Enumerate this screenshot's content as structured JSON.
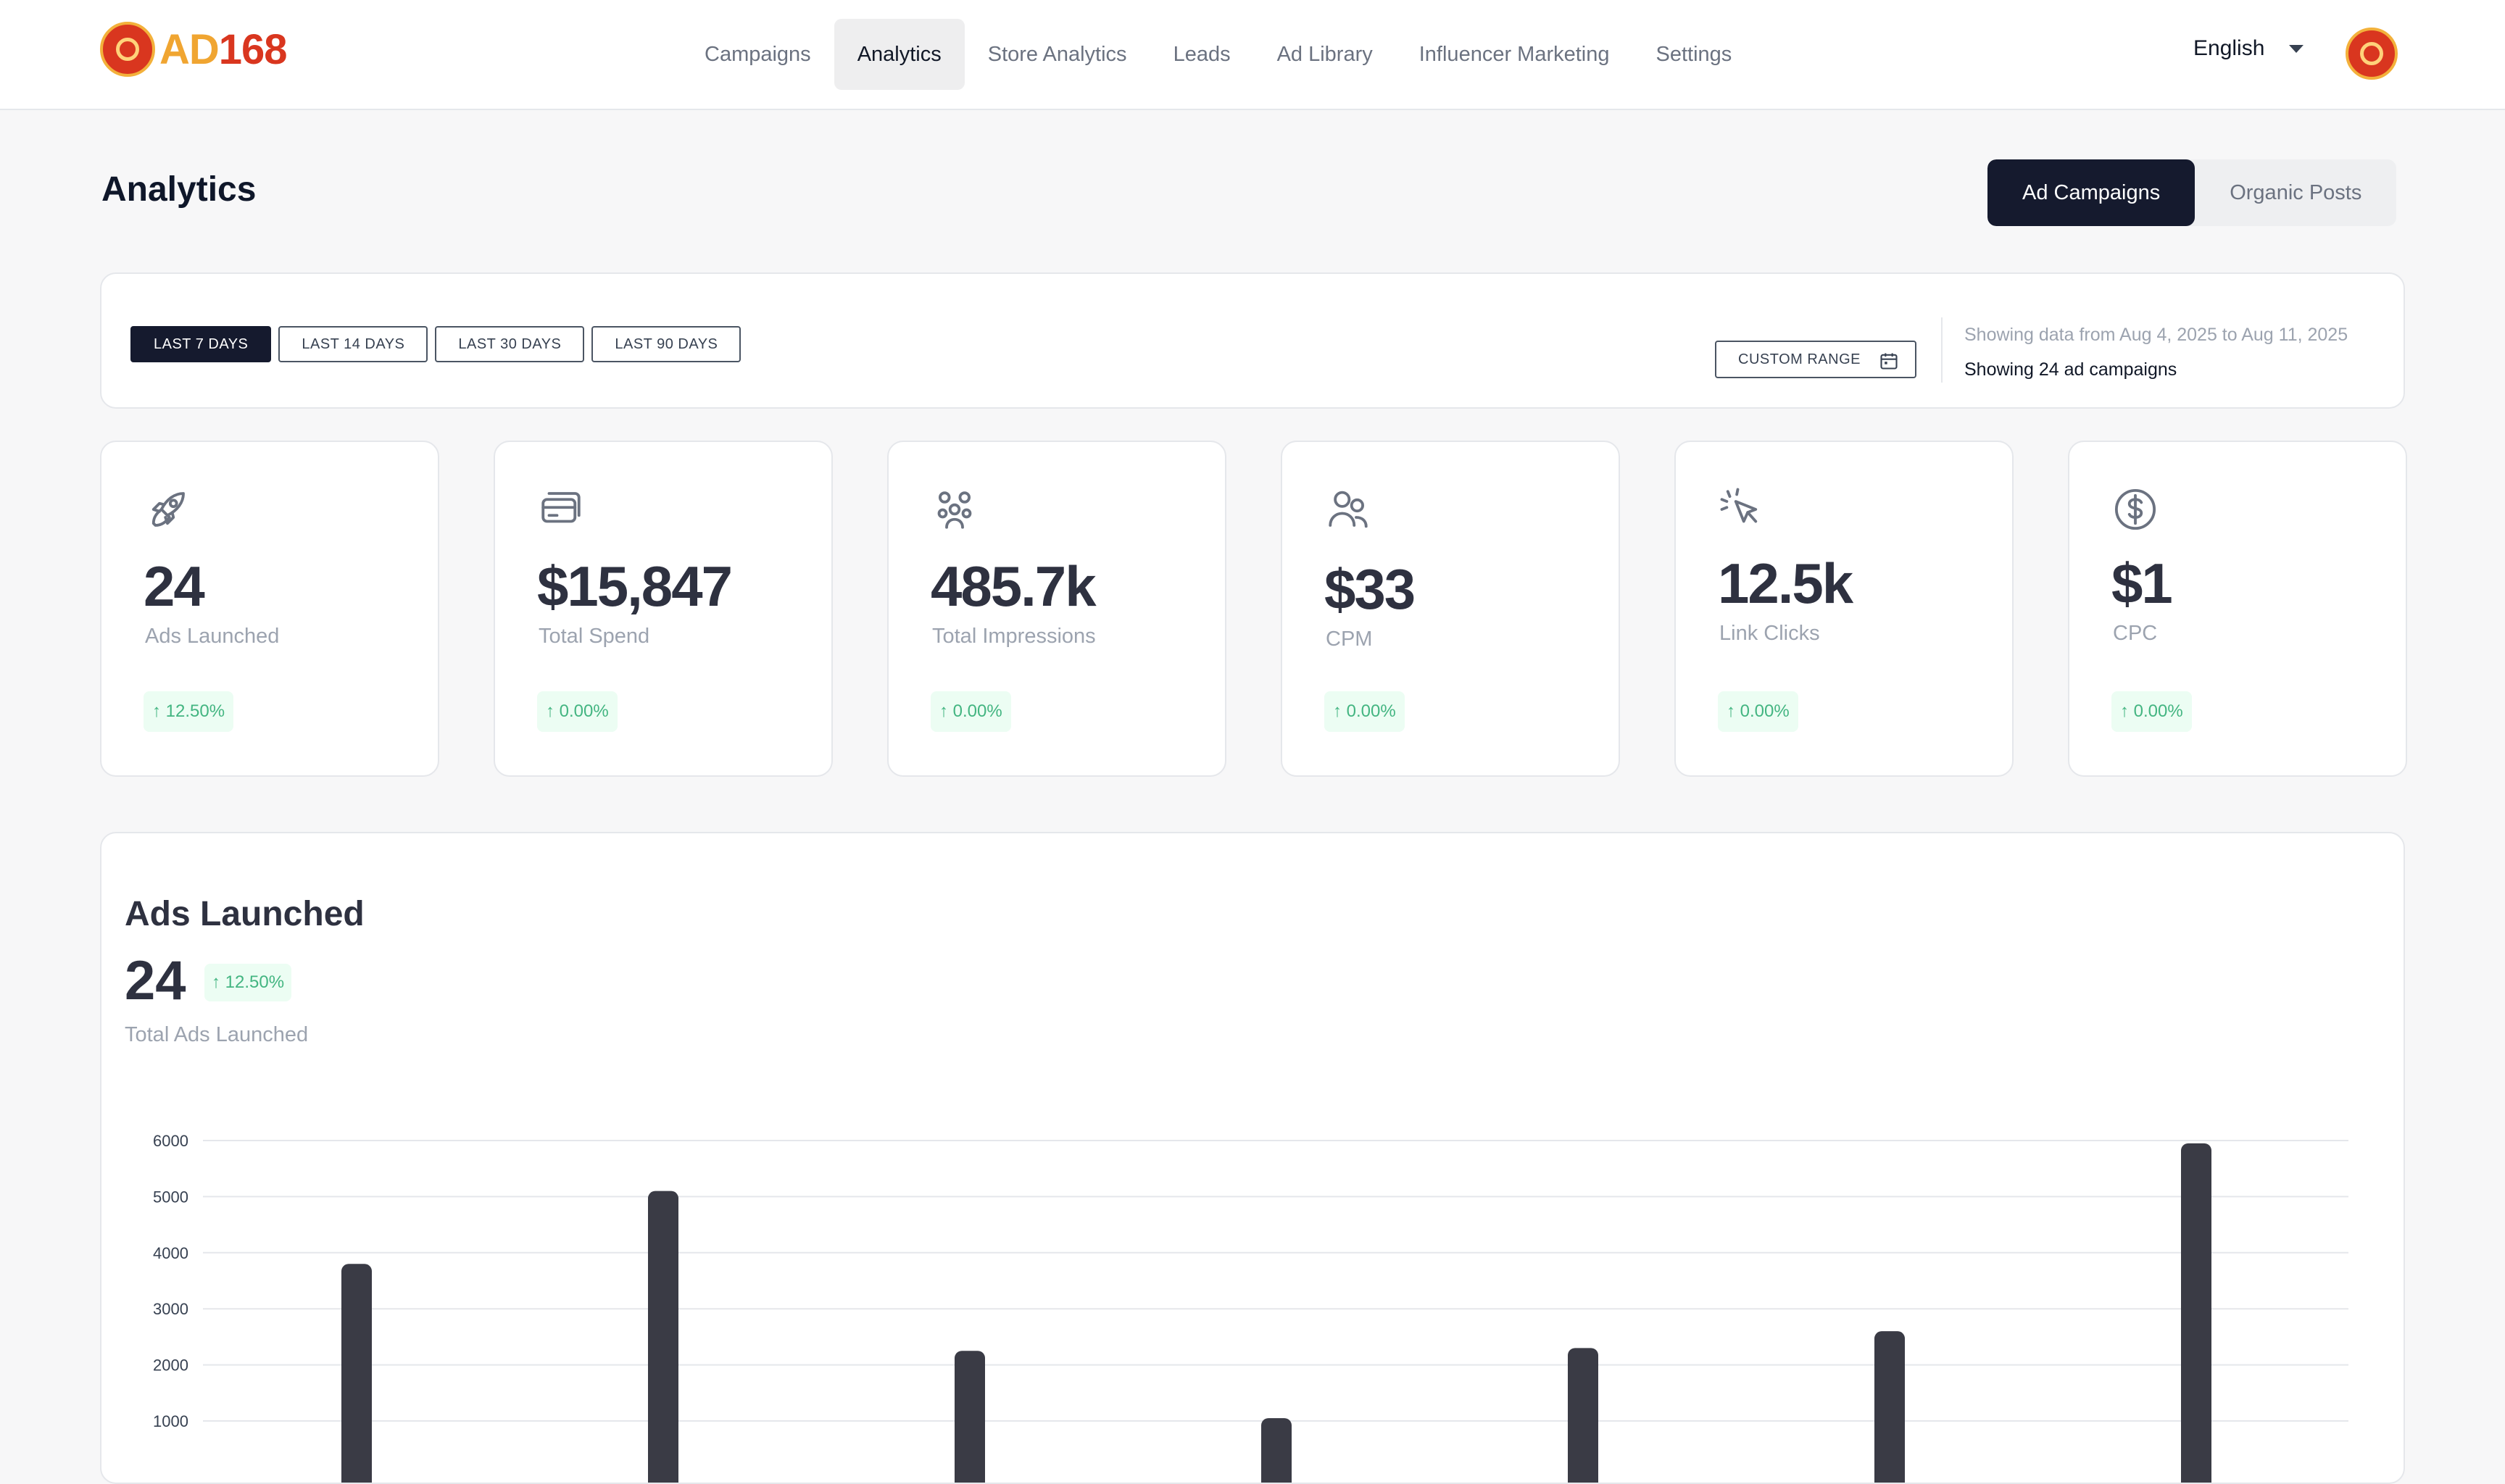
{
  "brand": {
    "name_part1": "AD",
    "name_part2": "168"
  },
  "nav": {
    "items": [
      "Campaigns",
      "Analytics",
      "Store Analytics",
      "Leads",
      "Ad Library",
      "Influencer Marketing",
      "Settings"
    ],
    "active": "Analytics"
  },
  "language": "English",
  "page": {
    "title": "Analytics",
    "toggle": [
      "Ad Campaigns",
      "Organic Posts"
    ],
    "toggle_active": "Ad Campaigns"
  },
  "filters": {
    "ranges": [
      "LAST 7 DAYS",
      "LAST 14 DAYS",
      "LAST 30 DAYS",
      "LAST 90 DAYS"
    ],
    "active": "LAST 7 DAYS",
    "custom_range": "CUSTOM RANGE",
    "showing_dates": "Showing data from Aug 4, 2025 to Aug 11, 2025",
    "showing_count": "Showing 24 ad campaigns"
  },
  "stats": [
    {
      "icon": "rocket-icon",
      "value": "24",
      "label": "Ads Launched",
      "change": "↑ 12.50%"
    },
    {
      "icon": "credit-card-icon",
      "value": "$15,847",
      "label": "Total Spend",
      "change": "↑ 0.00%"
    },
    {
      "icon": "group-icon",
      "value": "485.7k",
      "label": "Total Impressions",
      "change": "↑ 0.00%"
    },
    {
      "icon": "users-icon",
      "value": "$33",
      "label": "CPM",
      "change": "↑ 0.00%"
    },
    {
      "icon": "cursor-click-icon",
      "value": "12.5k",
      "label": "Link Clicks",
      "change": "↑ 0.00%"
    },
    {
      "icon": "dollar-circle-icon",
      "value": "$1",
      "label": "CPC",
      "change": "↑ 0.00%"
    }
  ],
  "chart": {
    "title": "Ads Launched",
    "total": "24",
    "change": "↑ 12.50%",
    "subtitle": "Total Ads Launched"
  },
  "chart_data": {
    "type": "bar",
    "values": [
      3800,
      5100,
      2250,
      1050,
      2300,
      2600,
      5950
    ],
    "ylim": [
      0,
      6000
    ],
    "yticks": [
      1000,
      2000,
      3000,
      4000,
      5000,
      6000
    ],
    "grid": true,
    "color": "#3a3b45"
  },
  "colors": {
    "accent_dark": "#151a2e",
    "positive": "#43b581",
    "positive_bg": "#ecfdf3",
    "brand_red": "#d9361f",
    "brand_orange": "#f0a531"
  }
}
